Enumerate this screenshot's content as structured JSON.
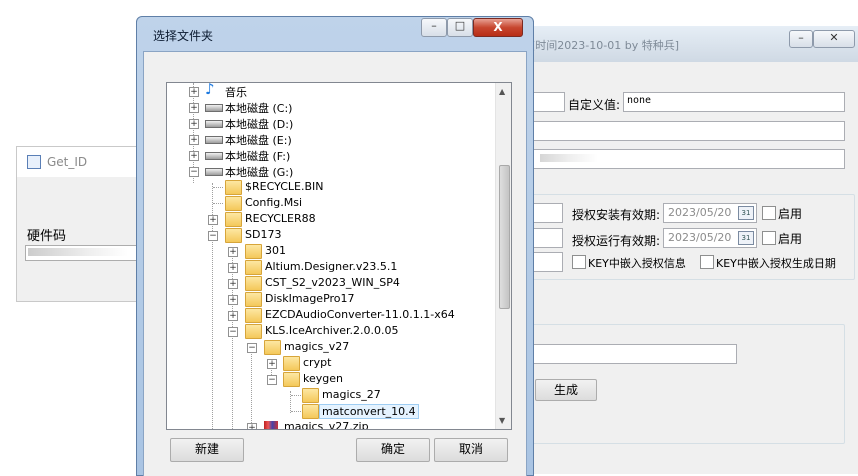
{
  "back_window": {
    "title": "Get_ID",
    "field_label": "硬件码",
    "field_value": "ECF0-87-0..."
  },
  "main_window": {
    "title_partial": "[时间2023-10-01 by 特种兵]",
    "custom_label": "自定义值:",
    "custom_value": "none",
    "install_valid_label": "授权安装有效期:",
    "install_date": "2023/05/20",
    "install_enable": "启用",
    "run_valid_label": "授权运行有效期:",
    "run_date": "2023/05/20",
    "run_enable": "启用",
    "embed_info": "KEY中嵌入授权信息",
    "embed_date": "KEY中嵌入授权生成日期",
    "generate": "生成",
    "cal_day": "31"
  },
  "dialog": {
    "title": "选择文件夹",
    "close": "X",
    "new_button": "新建",
    "ok_button": "确定",
    "cancel_button": "取消",
    "tree": [
      {
        "label": "音乐"
      },
      {
        "label": "本地磁盘 (C:)"
      },
      {
        "label": "本地磁盘 (D:)"
      },
      {
        "label": "本地磁盘 (E:)"
      },
      {
        "label": "本地磁盘 (F:)"
      },
      {
        "label": "本地磁盘 (G:)"
      },
      {
        "label": "$RECYCLE.BIN"
      },
      {
        "label": "Config.Msi"
      },
      {
        "label": "RECYCLER88"
      },
      {
        "label": "SD173"
      },
      {
        "label": "301"
      },
      {
        "label": "Altium.Designer.v23.5.1"
      },
      {
        "label": "CST_S2_v2023_WIN_SP4"
      },
      {
        "label": "DiskImagePro17"
      },
      {
        "label": "EZCDAudioConverter-11.0.1.1-x64"
      },
      {
        "label": "KLS.IceArchiver.2.0.0.05"
      },
      {
        "label": "magics_v27"
      },
      {
        "label": "crypt"
      },
      {
        "label": "keygen"
      },
      {
        "label": "magics_27"
      },
      {
        "label": "matconvert_10.4"
      },
      {
        "label": "magics_v27.zip"
      }
    ]
  }
}
